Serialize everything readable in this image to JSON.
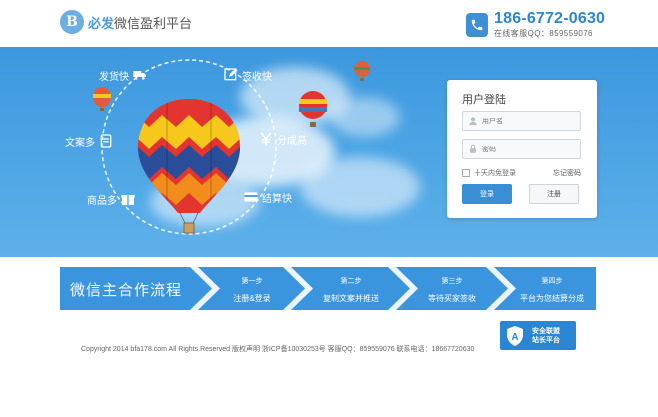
{
  "header": {
    "logo_mark": "B",
    "brand": "必发",
    "subtitle": "微信盈利平台",
    "phone": "186-6772-0630",
    "phone_note": "在线客服QQ：859559076"
  },
  "features": {
    "shipping": "发货快",
    "sign": "签收快",
    "copywriting": "文案多",
    "commission": "分成高",
    "products": "商品多",
    "settlement": "结算快"
  },
  "login": {
    "title": "用户登陆",
    "username_placeholder": "用户名",
    "password_placeholder": "密码",
    "remember": "十天内免登录",
    "forgot": "忘记密码",
    "login_button": "登录",
    "register_button": "注册"
  },
  "process": {
    "title": "微信主合作流程",
    "steps": [
      {
        "step": "第一步",
        "desc": "注册&登录"
      },
      {
        "step": "第二步",
        "desc": "复制文案并推送"
      },
      {
        "step": "第三步",
        "desc": "等待买家签收"
      },
      {
        "step": "第四步",
        "desc": "平台为您结算分成"
      }
    ]
  },
  "footer": {
    "copyright": "Copyright 2014 bfa178.com All Rights Reserved 版权声明 浙ICP备10030253号 客服QQ：859559076 联系电话：18667720630"
  },
  "badge": {
    "line1": "安全联盟",
    "line2": "站长平台",
    "letter": "A"
  },
  "colors": {
    "primary": "#3b95de",
    "sky": "#4aa3e4",
    "panel": "#ffffff"
  }
}
